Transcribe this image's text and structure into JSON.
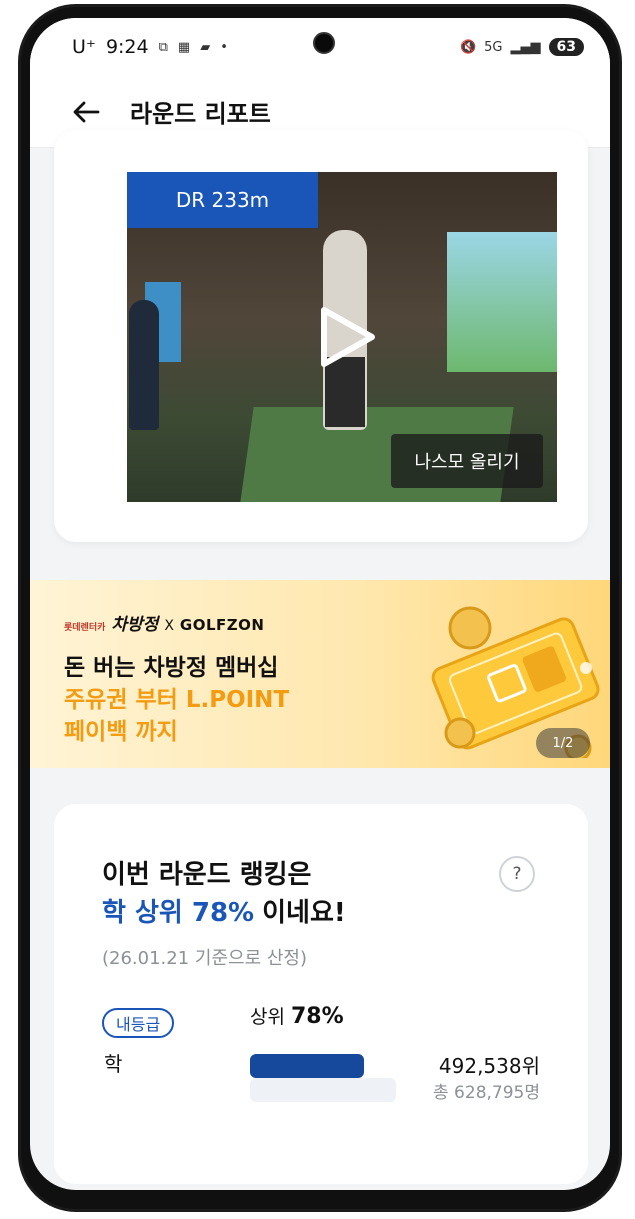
{
  "status_bar": {
    "carrier": "U⁺",
    "time": "9:24",
    "network": "5G",
    "battery": "63"
  },
  "app_bar": {
    "title": "라운드 리포트"
  },
  "video": {
    "distance_badge": "DR 233m",
    "upload_button": "나스모 올리기"
  },
  "banner": {
    "brand_small": "롯데렌터카",
    "brand_name": "차방정",
    "brand_x": "X",
    "brand_partner": "GOLFZON",
    "line1": "돈 버는 차방정 멤버십",
    "line2": "주유권 부터 L.POINT",
    "line3": "페이백 까지",
    "pager": "1/2"
  },
  "ranking": {
    "heading_line1": "이번 라운드 랭킹은",
    "heading_highlight": "학 상위 78%",
    "heading_suffix": "이네요!",
    "help": "?",
    "basis": "(26.01.21 기준으로 산정)",
    "my_grade_chip": "내등급",
    "grade": "학",
    "top_prefix": "상위",
    "top_percent": "78%",
    "top_fraction": 0.78,
    "position": "492,538위",
    "total": "총 628,795명"
  }
}
